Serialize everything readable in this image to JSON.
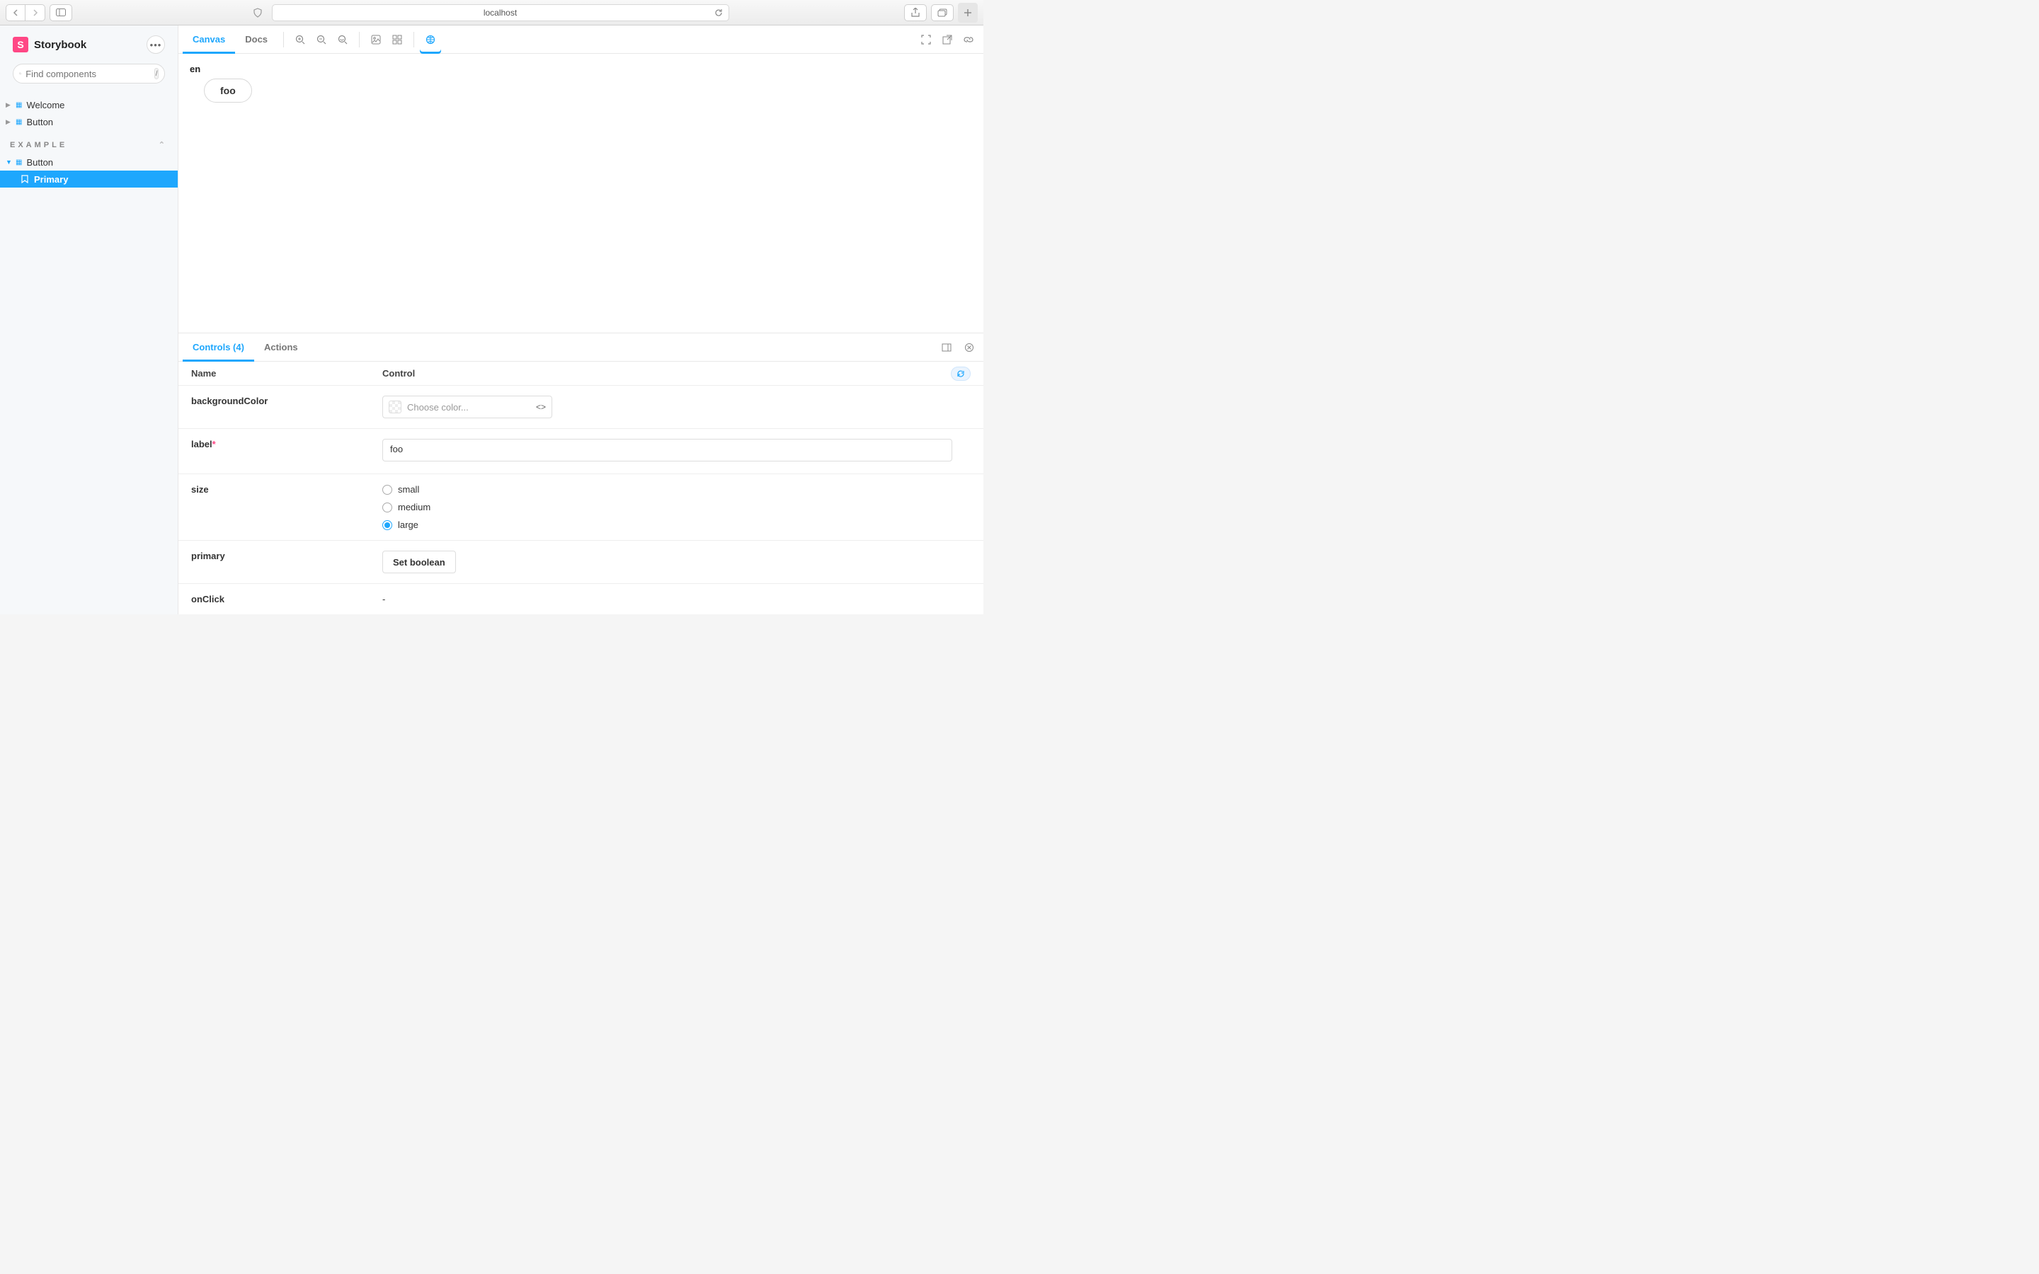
{
  "browser": {
    "address": "localhost"
  },
  "sidebar": {
    "brand": "Storybook",
    "search_placeholder": "Find components",
    "shortcut": "/",
    "nav_top": [
      {
        "label": "Welcome"
      },
      {
        "label": "Button"
      }
    ],
    "group_label": "EXAMPLE",
    "example_items": [
      {
        "label": "Button",
        "expanded": true
      }
    ],
    "stories": [
      {
        "label": "Primary",
        "selected": true
      }
    ]
  },
  "toolbar": {
    "tabs": [
      {
        "label": "Canvas",
        "active": true
      },
      {
        "label": "Docs",
        "active": false
      }
    ]
  },
  "preview": {
    "locale": "en",
    "button_label": "foo"
  },
  "addons": {
    "tabs": [
      {
        "label": "Controls (4)",
        "active": true
      },
      {
        "label": "Actions",
        "active": false
      }
    ],
    "columns": {
      "name": "Name",
      "control": "Control"
    },
    "controls": {
      "backgroundColor": {
        "name": "backgroundColor",
        "placeholder": "Choose color..."
      },
      "label": {
        "name": "label",
        "required": true,
        "value": "foo"
      },
      "size": {
        "name": "size",
        "options": [
          "small",
          "medium",
          "large"
        ],
        "value": "large"
      },
      "primary": {
        "name": "primary",
        "button_label": "Set boolean"
      },
      "onClick": {
        "name": "onClick",
        "value": "-"
      }
    }
  }
}
